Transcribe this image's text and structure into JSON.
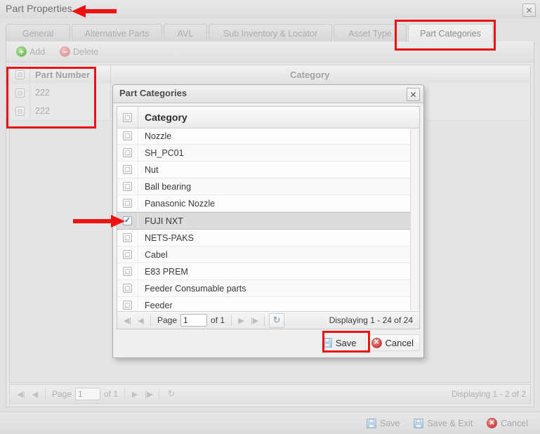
{
  "window": {
    "title": "Part Properties",
    "close_icon": "close-icon",
    "close_glyph": "✕"
  },
  "tabs": [
    {
      "label": "General",
      "active": false
    },
    {
      "label": "Alternative Parts",
      "active": false
    },
    {
      "label": "AVL",
      "active": false
    },
    {
      "label": "Sub Inventory & Locator",
      "active": false
    },
    {
      "label": "Asset Type",
      "active": false
    },
    {
      "label": "Part Categories",
      "active": true
    }
  ],
  "toolbar": {
    "add_label": "Add",
    "add_icon": "plus-circle-icon",
    "add_glyph": "+",
    "delete_label": "Delete",
    "delete_icon": "minus-circle-icon",
    "delete_glyph": "−"
  },
  "main_grid": {
    "columns": [
      "Part Number",
      "Category"
    ],
    "rows": [
      {
        "part_number": "222",
        "category": ""
      },
      {
        "part_number": "222",
        "category": ""
      }
    ]
  },
  "main_pager": {
    "first_icon": "first-page-icon",
    "prev_icon": "prev-page-icon",
    "next_icon": "next-page-icon",
    "last_icon": "last-page-icon",
    "refresh_icon": "refresh-icon",
    "first_glyph": "◀|",
    "prev_glyph": "◀",
    "next_glyph": "▶",
    "last_glyph": "|▶",
    "refresh_glyph": "↻",
    "page_label": "Page",
    "page_value": "1",
    "of_label": "of 1",
    "displaying": "Displaying 1 - 2 of 2"
  },
  "footer": {
    "save_label": "Save",
    "save_exit_label": "Save & Exit",
    "cancel_label": "Cancel",
    "save_icon": "floppy-disk-icon",
    "cancel_icon": "cancel-circle-icon",
    "cancel_glyph": "✕"
  },
  "modal": {
    "title": "Part Categories",
    "close_icon": "close-icon",
    "close_glyph": "✕",
    "column_header": "Category",
    "rows": [
      {
        "label": "Nozzle",
        "checked": false
      },
      {
        "label": "SH_PC01",
        "checked": false
      },
      {
        "label": "Nut",
        "checked": false
      },
      {
        "label": "Ball bearing",
        "checked": false
      },
      {
        "label": "Panasonic Nozzle",
        "checked": false
      },
      {
        "label": "FUJI NXT",
        "checked": true
      },
      {
        "label": "NETS-PAKS",
        "checked": false
      },
      {
        "label": "Cabel",
        "checked": false
      },
      {
        "label": "E83 PREM",
        "checked": false
      },
      {
        "label": "Feeder Consumable parts",
        "checked": false
      },
      {
        "label": "Feeder",
        "checked": false
      }
    ],
    "pager": {
      "first_glyph": "◀|",
      "prev_glyph": "◀",
      "next_glyph": "▶",
      "last_glyph": "|▶",
      "refresh_glyph": "↻",
      "page_label": "Page",
      "page_value": "1",
      "of_label": "of 1",
      "displaying": "Displaying 1 - 24 of 24"
    },
    "save_label": "Save",
    "cancel_label": "Cancel",
    "save_icon": "floppy-disk-icon",
    "cancel_icon": "cancel-circle-icon",
    "cancel_glyph": "✕"
  },
  "annotations": {
    "color": "#ee1111",
    "highlight_title_arrow": "arrow-pointing-to-part-properties-title",
    "highlight_tab": "highlight-part-categories-tab",
    "highlight_part_number_grid": "highlight-part-number-column",
    "highlight_modal_save": "highlight-modal-save-button",
    "arrow_to_fuji_checkbox": "arrow-pointing-to-fuji-nxt-checkbox"
  }
}
